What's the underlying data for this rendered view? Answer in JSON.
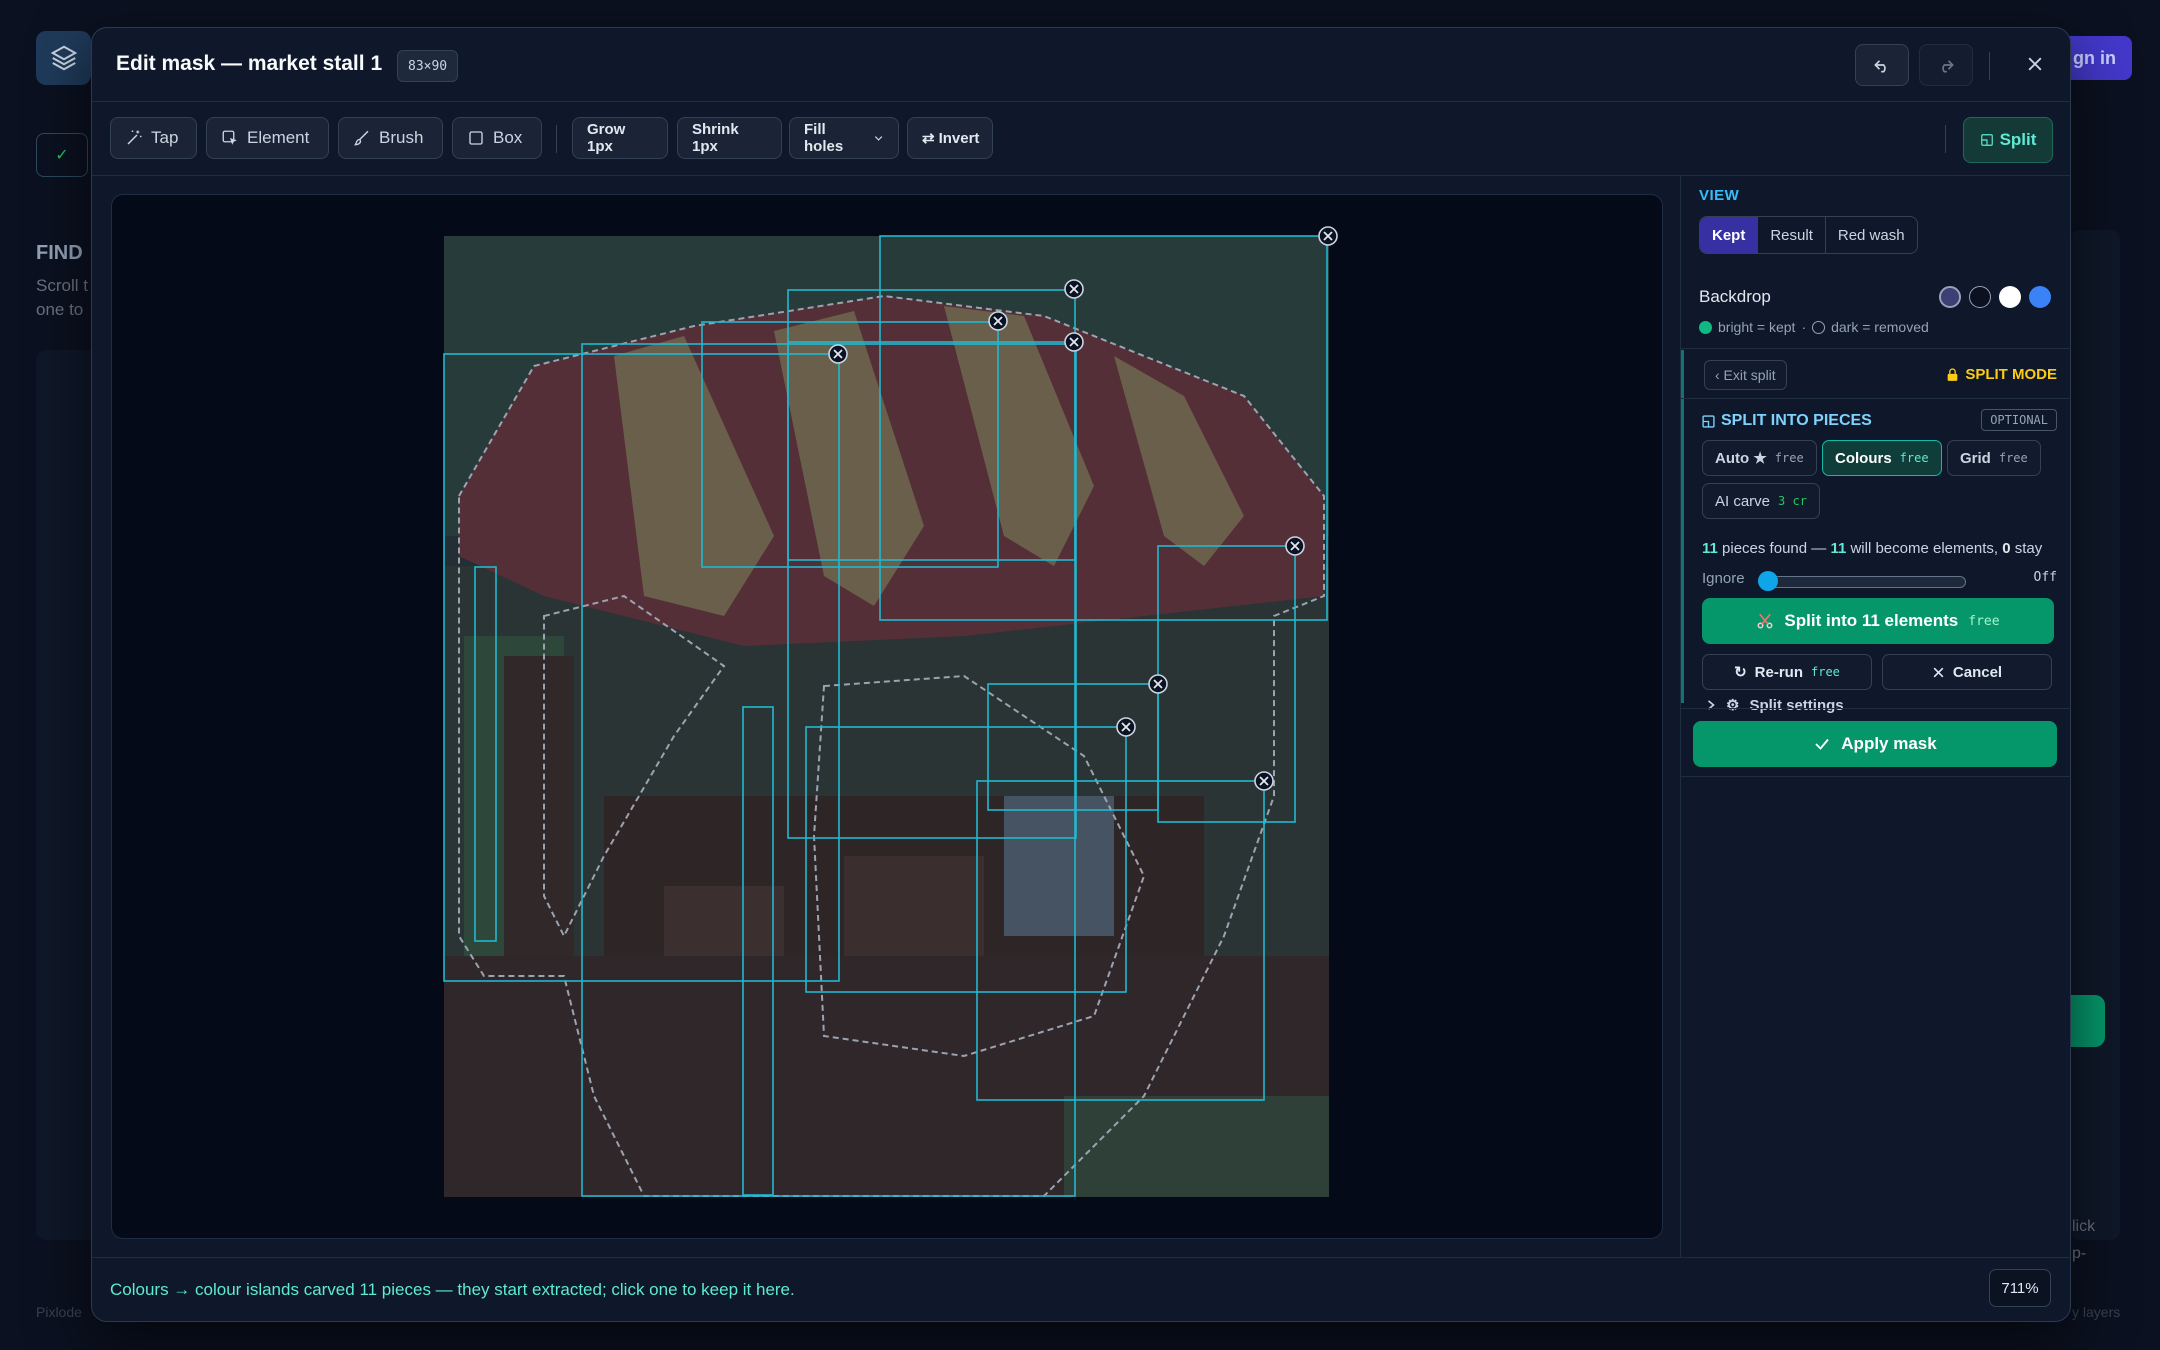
{
  "background": {
    "signin_label": "gn in",
    "find_label": "FIND",
    "scroll_hint": "Scroll t",
    "one_hint": "one to",
    "footer_left": "Pixlode",
    "footer_right": "y layers",
    "side_hint_1": "lick",
    "side_hint_2": "p-"
  },
  "modal": {
    "title": "Edit mask — market stall 1",
    "size_badge": "83×90"
  },
  "toolbar": {
    "tap": "Tap",
    "element": "Element",
    "brush": "Brush",
    "box": "Box",
    "grow": "Grow 1px",
    "shrink": "Shrink 1px",
    "fill_holes": "Fill holes",
    "invert": "Invert",
    "split": "Split"
  },
  "view": {
    "section": "VIEW",
    "modes": [
      "Kept",
      "Result",
      "Red wash"
    ],
    "active_mode": "Kept",
    "backdrop_label": "Backdrop",
    "backdrop_colors": [
      "#3b3f73",
      "#0b1120",
      "#ffffff",
      "#3b82f6"
    ],
    "legend_kept": "bright = kept",
    "legend_sep": "·",
    "legend_removed": "dark = removed"
  },
  "split": {
    "exit_label": "‹ Exit split",
    "mode_label": "SPLIT MODE",
    "heading": "SPLIT INTO PIECES",
    "optional": "OPTIONAL",
    "methods": [
      {
        "label": "Auto ★",
        "tag": "free"
      },
      {
        "label": "Colours",
        "tag": "free"
      },
      {
        "label": "Grid",
        "tag": "free"
      },
      {
        "label": "AI carve",
        "tag": "3 cr"
      }
    ],
    "active_method": "Colours",
    "found_count": "11",
    "found_text_1": "pieces found —",
    "elements_count": "11",
    "found_text_2": "will become elements,",
    "stay_count": "0",
    "found_text_3": "stay",
    "ignore_label": "Ignore",
    "ignore_value": "Off",
    "split_action": "Split into 11 elements",
    "split_action_tag": "free",
    "rerun": "Re-run",
    "rerun_tag": "free",
    "cancel": "Cancel",
    "settings": "Split settings"
  },
  "apply_label": "Apply mask",
  "footer": {
    "status": "Colours → colour islands carved 11 pieces — they start extracted; click one to keep it here.",
    "zoom": "711%"
  },
  "colors": {
    "accent_green": "#059669",
    "accent_teal": "#14b8a6",
    "piece_outline": "#22b8cf",
    "warning": "#facc15"
  }
}
